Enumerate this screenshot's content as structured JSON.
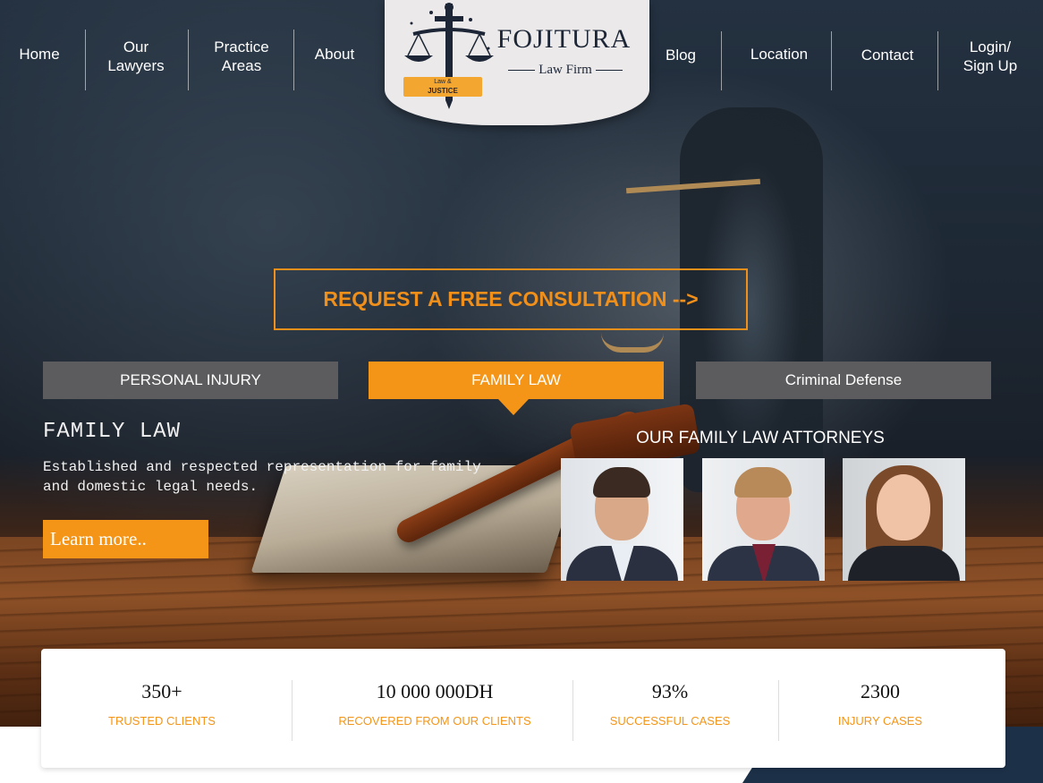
{
  "nav": {
    "left": [
      "Home",
      "Our Lawyers",
      "Practice Areas",
      "About"
    ],
    "right": [
      "Blog",
      "Location",
      "Contact",
      "Login/ Sign Up"
    ]
  },
  "logo": {
    "title": "FOJITURA",
    "subtitle": "Law Firm",
    "ribbon_top": "Law &",
    "ribbon_bottom": "JUSTICE"
  },
  "cta": {
    "label": "REQUEST A FREE CONSULTATION  -->"
  },
  "tabs": [
    {
      "label": "PERSONAL INJURY",
      "active": false
    },
    {
      "label": "FAMILY LAW",
      "active": true
    },
    {
      "label": "Criminal Defense",
      "active": false
    }
  ],
  "content": {
    "title": "FAMILY LAW",
    "description": "Established and respected representation for family and domestic legal needs.",
    "button": "Learn more.."
  },
  "attorneys": {
    "title": "OUR FAMILY LAW ATTORNEYS"
  },
  "stats": [
    {
      "value": "350+",
      "label": "TRUSTED CLIENTS"
    },
    {
      "value": "10 000 000DH",
      "label": "RECOVERED FROM OUR CLIENTS"
    },
    {
      "value": "93%",
      "label": "SUCCESSFUL CASES"
    },
    {
      "value": "2300",
      "label": "INJURY CASES"
    }
  ],
  "colors": {
    "accent": "#f49517",
    "tab_inactive": "#5c5c5e",
    "navy": "#1d2636"
  }
}
